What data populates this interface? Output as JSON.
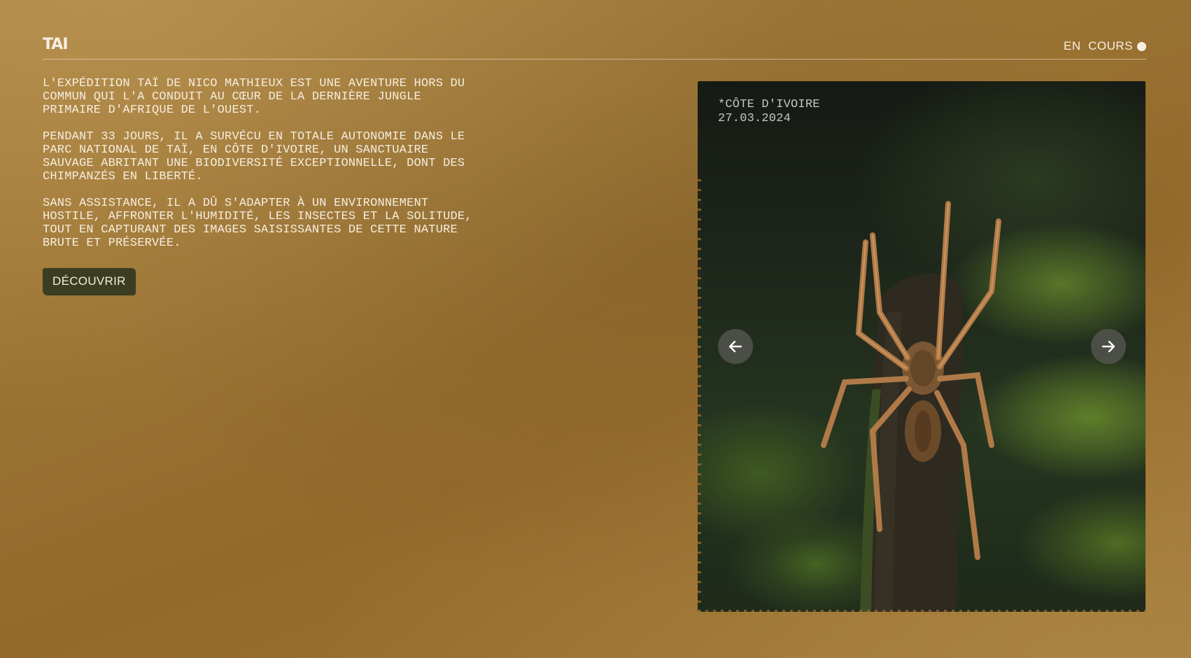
{
  "header": {
    "logo": "TAI",
    "status_label": "EN  COURS"
  },
  "intro": {
    "paragraphs": [
      "L'EXPÉDITION TAÏ DE NICO MATHIEUX EST UNE AVENTURE HORS DU\nCOMMUN QUI L'A CONDUIT AU CŒUR DE LA DERNIÈRE JUNGLE\nPRIMAIRE D'AFRIQUE DE L'OUEST.",
      "PENDANT 33 JOURS, IL A SURVÉCU EN TOTALE AUTONOMIE DANS LE\nPARC NATIONAL DE TAÏ, EN CÔTE D'IVOIRE, UN SANCTUAIRE\nSAUVAGE ABRITANT UNE BIODIVERSITÉ EXCEPTIONNELLE, DONT DES\nCHIMPANZÉS EN LIBERTÉ.",
      "SANS ASSISTANCE, IL A DÛ S'ADAPTER À UN ENVIRONNEMENT\nHOSTILE, AFFRONTER L'HUMIDITÉ, LES INSECTES ET LA SOLITUDE,\nTOUT EN CAPTURANT DES IMAGES SAISISSANTES DE CETTE NATURE\nBRUTE ET PRÉSERVÉE."
    ],
    "cta_label": "DÉCOUVRIR"
  },
  "photo": {
    "location": "*CÔTE D'IVOIRE",
    "date": "27.03.2024"
  },
  "icons": {
    "prev": "arrow-left-icon",
    "next": "arrow-right-icon",
    "status": "dot-icon"
  },
  "colors": {
    "background": "#9a7333",
    "text": "#f6eedf",
    "cta_background": "#3b3d22",
    "nav_button": "#5a5a56"
  }
}
